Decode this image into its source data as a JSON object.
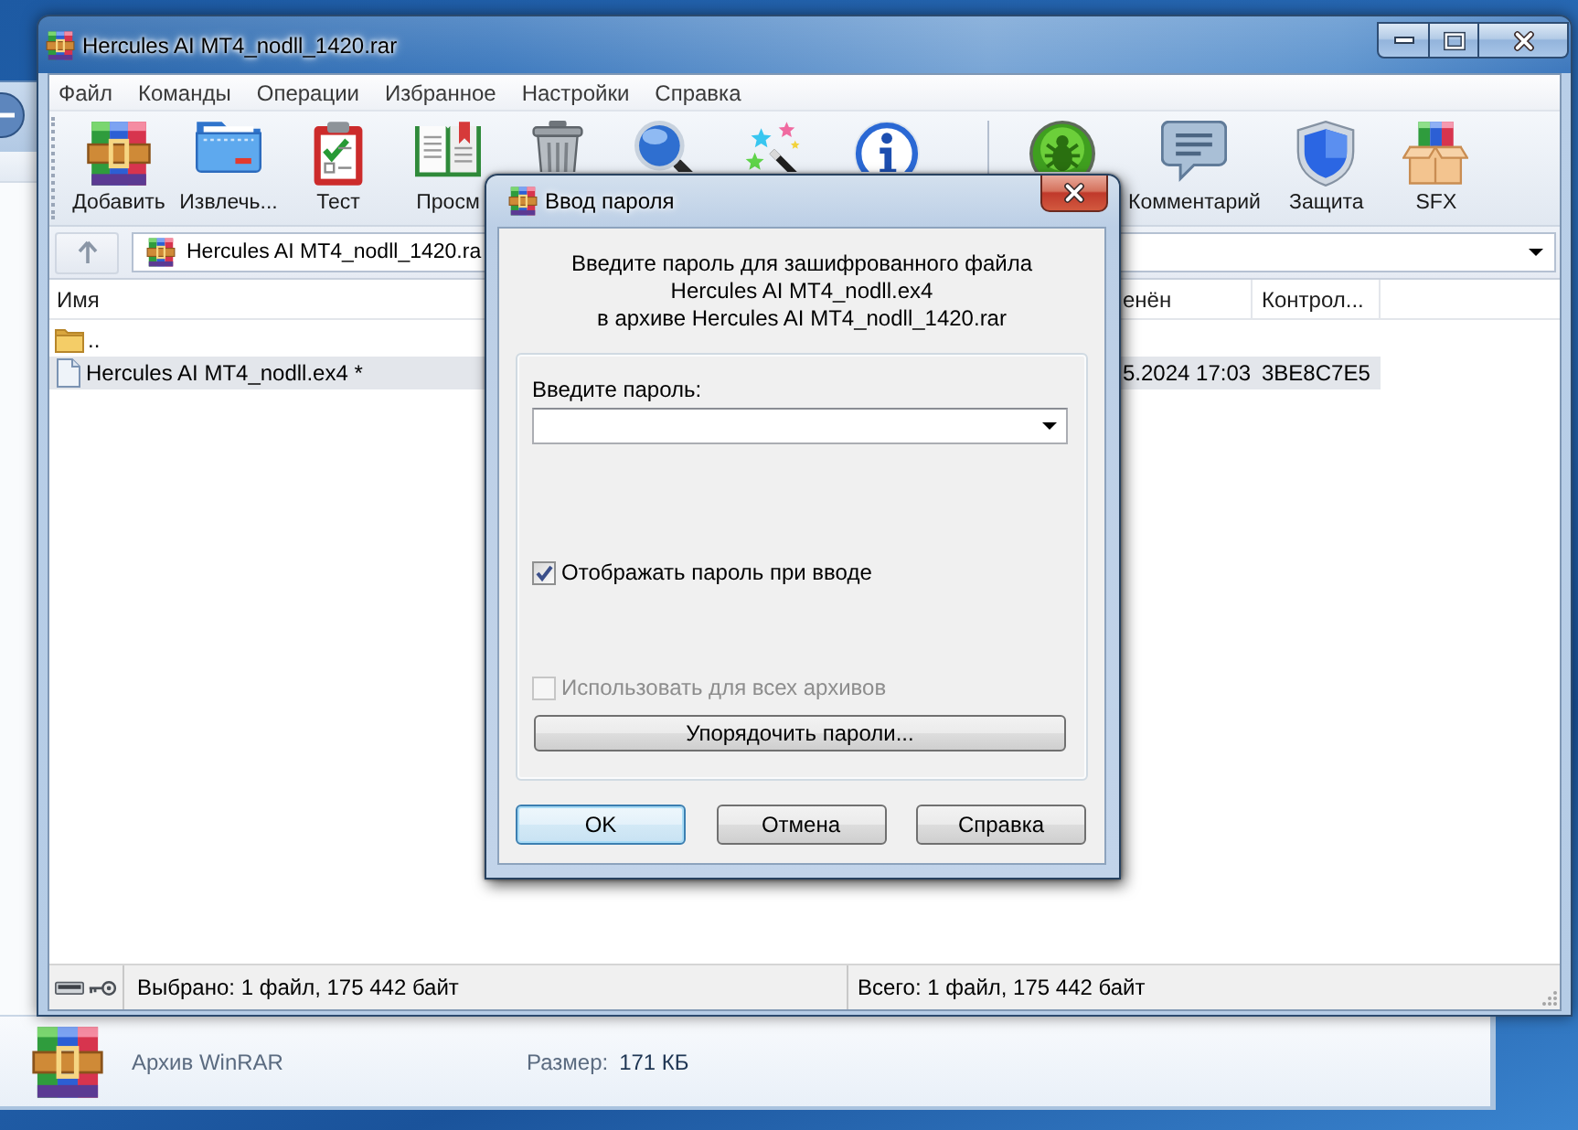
{
  "window": {
    "title": "Hercules AI MT4_nodll_1420.rar"
  },
  "menu": [
    "Файл",
    "Команды",
    "Операции",
    "Избранное",
    "Настройки",
    "Справка"
  ],
  "toolbar": {
    "main": [
      {
        "kind": "add",
        "label": "Добавить"
      },
      {
        "kind": "extract",
        "label": "Извлечь..."
      },
      {
        "kind": "test",
        "label": "Тест"
      },
      {
        "kind": "view",
        "label": "Просм"
      },
      {
        "kind": "delete"
      },
      {
        "kind": "find"
      },
      {
        "kind": "wizard"
      },
      {
        "kind": "info"
      }
    ],
    "extra": [
      {
        "kind": "virus_scan"
      },
      {
        "kind": "comment",
        "label": "Комментарий"
      },
      {
        "kind": "protect",
        "label": "Защита"
      },
      {
        "kind": "sfx",
        "label": "SFX"
      }
    ]
  },
  "address": {
    "path": "Hercules AI MT4_nodll_1420.ra"
  },
  "file_list": {
    "columns": [
      {
        "label": "Имя"
      },
      {
        "label": "енён"
      },
      {
        "label": "Контрол..."
      }
    ],
    "rows": [
      {
        "kind": "parent_folder",
        "name": "..",
        "selected": false
      },
      {
        "kind": "file",
        "name": "Hercules AI MT4_nodll.ex4 *",
        "column_2": "5.2024 17:03",
        "column_3": "3BE8C7E5",
        "selected": true
      }
    ]
  },
  "status_bar": {
    "selection": "Выбрано: 1 файл, 175 442 байт",
    "total": "Всего: 1 файл, 175 442 байт"
  },
  "details_pane": {
    "file_type": "Архив WinRAR",
    "size_label": "Размер:",
    "size": "171 КБ"
  },
  "dialog": {
    "title": "Ввод пароля",
    "message": "Введите пароль для зашифрованного файла\nHercules AI MT4_nodll.ex4\nв архиве Hercules AI MT4_nodll_1420.rar",
    "password_label": "Введите пароль:",
    "options": [
      {
        "label": "Отображать пароль при вводе",
        "checked": true,
        "disabled": false
      },
      {
        "label": "Использовать для всех архивов",
        "checked": false,
        "disabled": true
      }
    ],
    "organize_button": "Упорядочить пароли...",
    "buttons": [
      {
        "label": "OK",
        "default": true
      },
      {
        "label": "Отмена",
        "default": false
      },
      {
        "label": "Справка",
        "default": false
      }
    ]
  }
}
